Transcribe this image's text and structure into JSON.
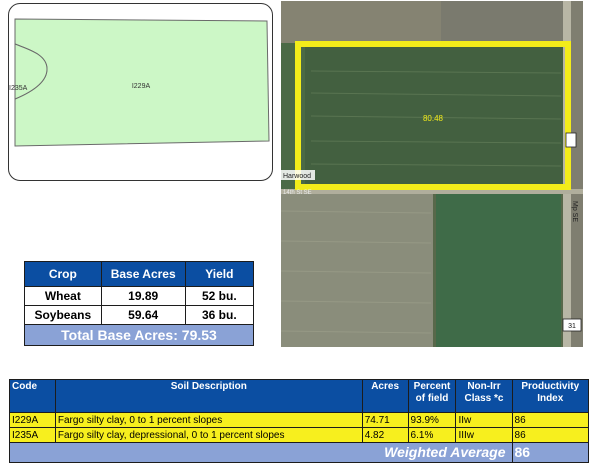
{
  "soil_map": {
    "label_main": "I229A",
    "label_small": "I235A"
  },
  "aerial": {
    "field_acres_label": "80.48",
    "road_label_1": "Harwood",
    "road_label_2": "14th St SE",
    "road_label_3": "Mp SE",
    "marker_31": "31",
    "colors": {
      "highlight": "#f3ec1a",
      "field_fill": "#44633f"
    }
  },
  "crop_table": {
    "headers": [
      "Crop",
      "Base Acres",
      "Yield"
    ],
    "rows": [
      [
        "Wheat",
        "19.89",
        "52 bu."
      ],
      [
        "Soybeans",
        "59.64",
        "36 bu."
      ]
    ],
    "total_label": "Total Base Acres:",
    "total_value": "79.53"
  },
  "soil_table": {
    "headers": {
      "code": "Code",
      "description": "Soil Description",
      "acres": "Acres",
      "percent": "Percent of field",
      "class": "Non-Irr Class *c",
      "productivity": "Productivity Index"
    },
    "rows": [
      [
        "I229A",
        "Fargo silty clay, 0 to 1 percent slopes",
        "74.71",
        "93.9%",
        "IIw",
        "86"
      ],
      [
        "I235A",
        "Fargo silty clay, depressional, 0 to 1 percent slopes",
        "4.82",
        "6.1%",
        "IIIw",
        "86"
      ]
    ],
    "weighted_label": "Weighted Average",
    "weighted_value": "86"
  },
  "colors": {
    "header_blue": "#0b4ea2",
    "total_blue": "#8aa2d6",
    "row_yellow": "#f7ef1e",
    "soil_green": "#ccf7c6"
  }
}
